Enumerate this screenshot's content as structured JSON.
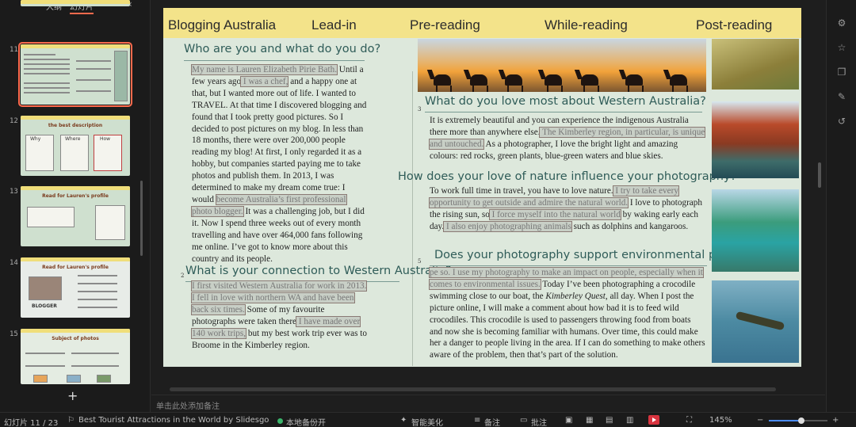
{
  "left_panel": {
    "tab_outline": "大纲",
    "tab_slides": "幻灯片",
    "collapse_icon": "chevron-left-icon",
    "thumbnails": [
      {
        "num": "11",
        "active": true
      },
      {
        "num": "12",
        "title": "the best description",
        "labels": [
          "Why",
          "Where",
          "How"
        ]
      },
      {
        "num": "13",
        "title": "Read for Lauren's profile"
      },
      {
        "num": "14",
        "title": "Read for Lauren's profile",
        "caption": "BLOGGER"
      },
      {
        "num": "15",
        "title": "Subject of photos"
      }
    ],
    "add_icon": "+"
  },
  "slide": {
    "nav": {
      "blogging": "Blogging Australia",
      "lead_in": "Lead-in",
      "pre_reading": "Pre-reading",
      "while_reading": "While-reading",
      "post_reading": "Post-reading"
    },
    "q1": {
      "heading": "Who are you and what do you do?",
      "hl_1": "My name is Lauren Elizabeth Pirie Bath.",
      "t_1": " Until a few years ago",
      "hl_2": " I was a chef,",
      "t_2": " and a happy one at that, but I wanted more out of life. I wanted to TRAVEL. At that time I discovered blogging and found that I took pretty good pictures. So I decided to post pictures on my blog. In less than 18 months, there were over 200,000 people reading my blog! At first, I only regarded it as a hobby, but companies started paying me to take photos and publish them. In 2013, I was determined to make my dream come true: I would ",
      "hl_3": "become Australia’s first professional photo blogger.",
      "t_3": " It was a challenging job, but I did it. Now I spend three weeks out of every month travelling and have over 464,000 fans following me online. I’ve got to know more about this country and its people."
    },
    "q2": {
      "num": "2",
      "heading": "What is your connection to Western Australia?",
      "hl_1": "I first visited Western Australia for work in 2013. I fell in love with northern WA and have been back six times.",
      "t_1": " Some of my favourite photographs were taken there",
      "hl_2": " I have made over 140 work trips,",
      "t_2": " but my best work trip ever was to Broome in the Kimberley region."
    },
    "q3": {
      "num": "3",
      "heading": "What do you love most about Western Australia?",
      "t_1": "It is extremely beautiful and you can experience the indigenous Australia there more than anywhere else.",
      "hl_1": " The Kimberley region, in particular, is unique and untouched.",
      "t_2": " As a photographer, I love the bright light and amazing colours: red rocks, green plants, blue-green waters and blue skies."
    },
    "q4": {
      "heading": "How does your love of nature influence your photography?",
      "t_1": "To work full time in travel, you have to love nature.",
      "hl_1": " I try to take every opportunity to get outside and admire the natural world.",
      "t_2": " I love to photograph the rising sun, so",
      "hl_2": " I force myself into the natural world",
      "t_3": " by waking early each day.",
      "hl_3": " I also enjoy photographing animals",
      "t_4": " such as dolphins and kangaroos."
    },
    "q5": {
      "num": "5",
      "heading": "Does your photography support environmental protection?",
      "hl_1": "pe so. I use my photography to make an impact on people, especially when it comes to environmental issues.",
      "t_1": " Today I’ve been photographing a crocodile swimming close to our boat, the ",
      "boat": "Kimberley Quest",
      "t_2": ", all day. When I post the picture online, I will make a comment about how bad it is to feed wild crocodiles. This crocodile is used to passengers throwing food from boats and now she is becoming familiar with humans. Over time, this could make her a danger to people living in the area. If I can do something to make others aware of the problem, then that’s part of the solution."
    }
  },
  "notes": {
    "placeholder": "单击此处添加备注"
  },
  "right_toolbar": [
    "settings-sliders-icon",
    "star-icon",
    "copy-icon",
    "magic-icon",
    "history-icon"
  ],
  "status_bar": {
    "slide_num": "幻灯片 11 / 23",
    "theme": "Best Tourist Attractions in the World by Slidesgo",
    "backup": "本地备份开",
    "beautify": "智能美化",
    "notes": "备注",
    "comment": "批注",
    "zoom": "145%",
    "zoom_level": 0.55
  },
  "colors": {
    "nav_bar": "#f3e38a",
    "heading": "#2f5c58",
    "accent": "#ff6a4d",
    "slide_bg": "#dde8dc"
  }
}
